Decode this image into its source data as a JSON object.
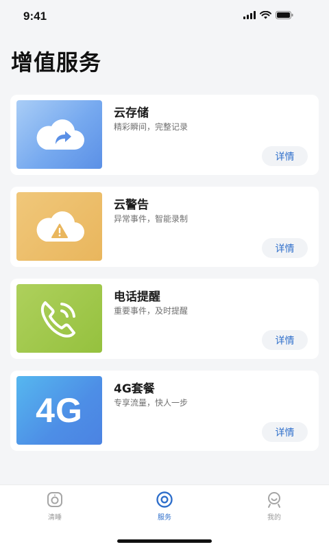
{
  "status_bar": {
    "time": "9:41"
  },
  "page": {
    "title": "增值服务"
  },
  "services": [
    {
      "title": "云存储",
      "subtitle": "精彩瞬间，完整记录",
      "button": "详情",
      "icon": "cloud-share-icon"
    },
    {
      "title": "云警告",
      "subtitle": "异常事件，智能录制",
      "button": "详情",
      "icon": "cloud-warning-icon"
    },
    {
      "title": "电话提醒",
      "subtitle": "重要事件，及时提醒",
      "button": "详情",
      "icon": "phone-ringing-icon"
    },
    {
      "title": "4G套餐",
      "subtitle": "专享流量，快人一步",
      "button": "详情",
      "thumb_text": "4G"
    }
  ],
  "tabs": [
    {
      "label": "清睡",
      "icon": "camera-icon",
      "active": false
    },
    {
      "label": "服务",
      "icon": "service-icon",
      "active": true
    },
    {
      "label": "我的",
      "icon": "profile-icon",
      "active": false
    }
  ],
  "colors": {
    "accent": "#2f6fcb",
    "background": "#f4f5f7"
  }
}
